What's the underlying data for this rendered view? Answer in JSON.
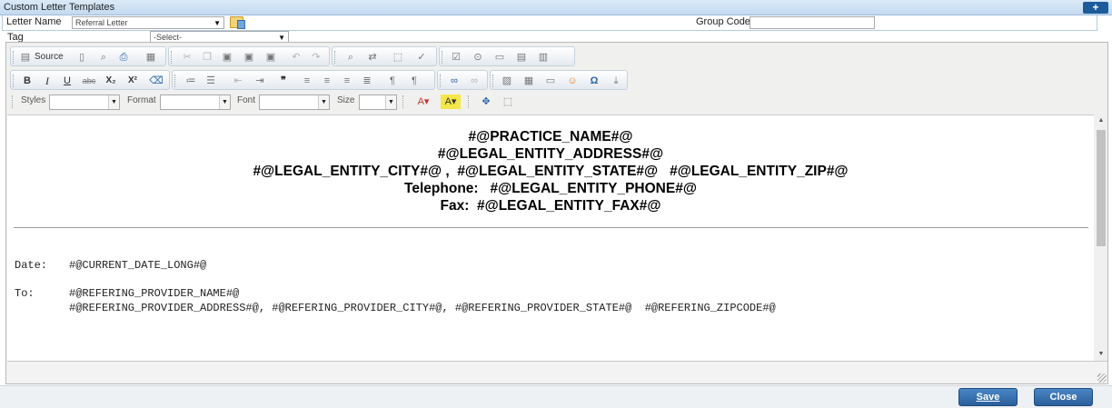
{
  "window": {
    "title": "Custom Letter Templates",
    "add_label": "+"
  },
  "form": {
    "letter_name_label": "Letter Name",
    "letter_name_value": "Referral Letter",
    "group_code_label": "Group Code:",
    "group_code_value": "",
    "tag_label": "Tag",
    "tag_value": "-Select-"
  },
  "toolbar": {
    "source_label": "Source",
    "styles_label": "Styles",
    "format_label": "Format",
    "font_label": "Font",
    "size_label": "Size",
    "bold": "B",
    "italic": "I",
    "underline": "U",
    "strike": "abc",
    "subscript": "X₂",
    "superscript": "X²",
    "omega": "Ω",
    "blockquote": "❞"
  },
  "letter": {
    "header_lines": [
      "#@PRACTICE_NAME#@",
      "#@LEGAL_ENTITY_ADDRESS#@",
      "#@LEGAL_ENTITY_CITY#@ ,  #@LEGAL_ENTITY_STATE#@   #@LEGAL_ENTITY_ZIP#@",
      "Telephone:   #@LEGAL_ENTITY_PHONE#@",
      "Fax:  #@LEGAL_ENTITY_FAX#@"
    ],
    "date_label": "Date:",
    "date_value": "#@CURRENT_DATE_LONG#@",
    "to_label": "To:",
    "to_line1": "#@REFERING_PROVIDER_NAME#@",
    "to_line2": "#@REFERING_PROVIDER_ADDRESS#@, #@REFERING_PROVIDER_CITY#@, #@REFERING_PROVIDER_STATE#@  #@REFERING_ZIPCODE#@"
  },
  "footer": {
    "save_label": "Save",
    "close_label": "Close"
  }
}
